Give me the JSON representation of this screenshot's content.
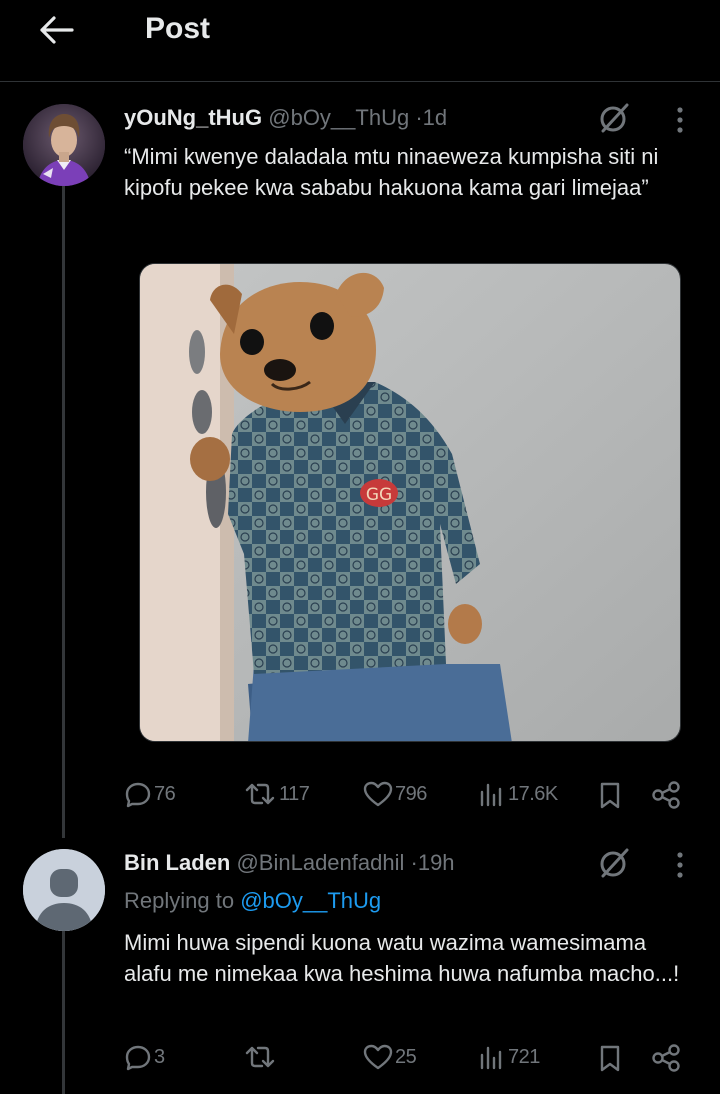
{
  "header": {
    "title": "Post"
  },
  "tweet": {
    "display_name": "yOuNg_tHuG",
    "handle": "@bOy__ThUg",
    "dot": "·",
    "time": "1d",
    "text": "“Mimi kwenye daladala mtu ninaeweza kumpisha siti ni kipofu pekee kwa sababu hakuona kama gari limejaa”",
    "stats": {
      "replies": "76",
      "reposts": "117",
      "likes": "796",
      "views": "17.6K"
    }
  },
  "reply": {
    "display_name": "Bin Laden",
    "handle": "@BinLadenfadhil",
    "dot": "·",
    "time": "19h",
    "replying_label": "Replying to",
    "replying_to": "@bOy__ThUg",
    "text": "Mimi huwa sipendi kuona watu wazima wamesimama alafu me nimekaa kwa heshima huwa nafumba macho...!",
    "stats": {
      "replies": "3",
      "reposts": "",
      "likes": "25",
      "views": "721"
    }
  },
  "icons": [
    "back-arrow-icon",
    "grok-icon",
    "more-icon",
    "reply-icon",
    "repost-icon",
    "like-icon",
    "views-icon",
    "bookmark-icon",
    "share-icon"
  ],
  "colors": {
    "background": "#000000",
    "text": "#e7e9ea",
    "muted": "#71767b",
    "link": "#1d9bf0",
    "divider": "#2f3336"
  }
}
